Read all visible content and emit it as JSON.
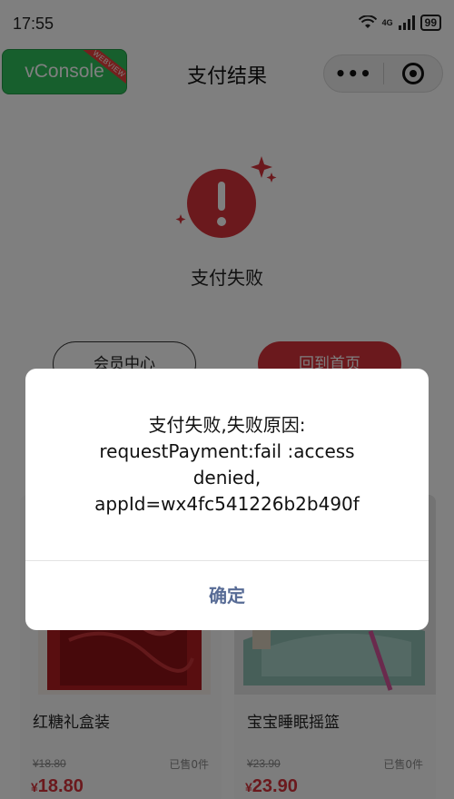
{
  "status_bar": {
    "time": "17:55",
    "signal_label": "4G",
    "battery": "99"
  },
  "nav": {
    "title": "支付结果",
    "vconsole_label": "vConsole",
    "vconsole_tag": "WEBVIEW",
    "more_icon": "more-dots-icon",
    "close_icon": "target-close-icon"
  },
  "result": {
    "status_text": "支付失败",
    "icon": "exclamation-error-icon",
    "accent_color": "#d6323a"
  },
  "actions": {
    "member_center_label": "会员中心",
    "home_label": "回到首页"
  },
  "products": [
    {
      "name": "红糖礼盒装",
      "original_price": "¥18.80",
      "sold": "已售0件",
      "price_symbol": "¥",
      "price": "18.80"
    },
    {
      "name": "宝宝睡眠摇篮",
      "original_price": "¥23.90",
      "sold": "已售0件",
      "price_symbol": "¥",
      "price": "23.90"
    }
  ],
  "dialog": {
    "message_lines": [
      "支付失败,失败原因:",
      "requestPayment:fail :access",
      "denied,",
      "appId=wx4fc541226b2b490f"
    ],
    "confirm_label": "确定",
    "confirm_color": "#576b95"
  }
}
